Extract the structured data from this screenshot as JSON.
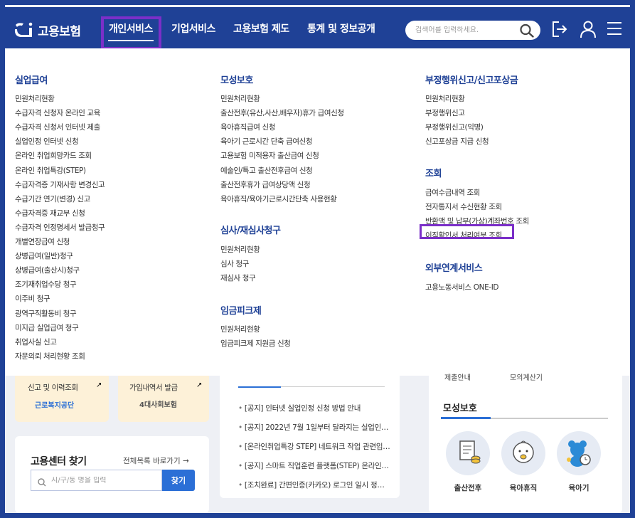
{
  "header": {
    "logo_text": "고용보험",
    "nav": [
      "개인서비스",
      "기업서비스",
      "고용보험 제도",
      "통계 및 정보공개"
    ],
    "active_nav": "개인서비스",
    "search_placeholder": "검색어를 입력하세요."
  },
  "menu": {
    "unemployment": {
      "title": "실업급여",
      "links": [
        "민원처리현황",
        "수급자격 신청자 온라인 교육",
        "수급자격 신청서 인터넷 제출",
        "실업인정 인터넷 신청",
        "온라인 취업희망카드 조회",
        "온라인 취업특강(STEP)",
        "수급자격증 기재사항 변경신고",
        "수급기간 연기(변경) 신고",
        "수급자격증 재교부 신청",
        "수급자격 인정명세서 발급청구",
        "개별연장급여 신청",
        "상병급여(일반)청구",
        "상병급여(출산시)청구",
        "조기재취업수당 청구",
        "이주비 청구",
        "광역구직활동비 청구",
        "미지급 실업급여 청구",
        "취업사실 신고",
        "자문의뢰 처리현황 조회"
      ]
    },
    "maternity": {
      "title": "모성보호",
      "links": [
        "민원처리현황",
        "출산전후(유산,사산,배우자)휴가 급여신청",
        "육아휴직급여 신청",
        "육아기 근로시간 단축 급여신청",
        "고용보험 미적용자 출산급여 신청",
        "예술인/특고 출산전후급여 신청",
        "출산전후휴가 급여상당액 신청",
        "육아휴직/육아기근로시간단축 사용현황"
      ]
    },
    "review": {
      "title": "심사/재심사청구",
      "links": [
        "민원처리현황",
        "심사 청구",
        "재심사 청구"
      ]
    },
    "wage_peak": {
      "title": "임금피크제",
      "links": [
        "민원처리현황",
        "임금피크제 지원금 신청"
      ]
    },
    "fraud": {
      "title": "부정행위신고/신고포상금",
      "links": [
        "민원처리현황",
        "부정행위신고",
        "부정행위신고(익명)",
        "신고포상금 지급 신청"
      ]
    },
    "inquiry": {
      "title": "조회",
      "links": [
        "급여수급내역 조회",
        "전자통지서 수신현황 조회",
        "반환액 및 납부(가상)계좌번호 조회",
        "이직확인서 처리여부 조회"
      ]
    },
    "external": {
      "title": "외부연계서비스",
      "links": [
        "고용노동서비스 ONE-ID"
      ]
    }
  },
  "bottom": {
    "yellow1_label": "신고 및 이력조회",
    "yellow1_org": "근로복지공단",
    "yellow2_label": "가입내역서 발급",
    "yellow2_org": "4대사회보험",
    "find_title": "고용센터 찾기",
    "find_link": "전체목록 바로가기",
    "find_placeholder": "시/구/동 명을 입력",
    "find_button": "찾기",
    "news": [
      "[공지] 인터넷 실업인정 신청 방법 안내",
      "[공지] 2022년 7월 1일부터 달라지는 실업인…",
      "[온라인취업특강 STEP] 네트워크 작업 관련입…",
      "[공지] 스마트 직업훈련 플랫폼(STEP) 온라인…",
      "[조치완료] 간편인증(카카오) 로그인 일시 정…"
    ],
    "mo_title": "모성보호",
    "mo_items": [
      "출산전후",
      "육아휴직",
      "육아기"
    ],
    "top_partial_left": "제출안내",
    "top_partial_right": "모의계산기"
  },
  "colors": {
    "brand": "#1f4196",
    "highlight": "#7b2fc8",
    "button": "#2b6fd6"
  }
}
